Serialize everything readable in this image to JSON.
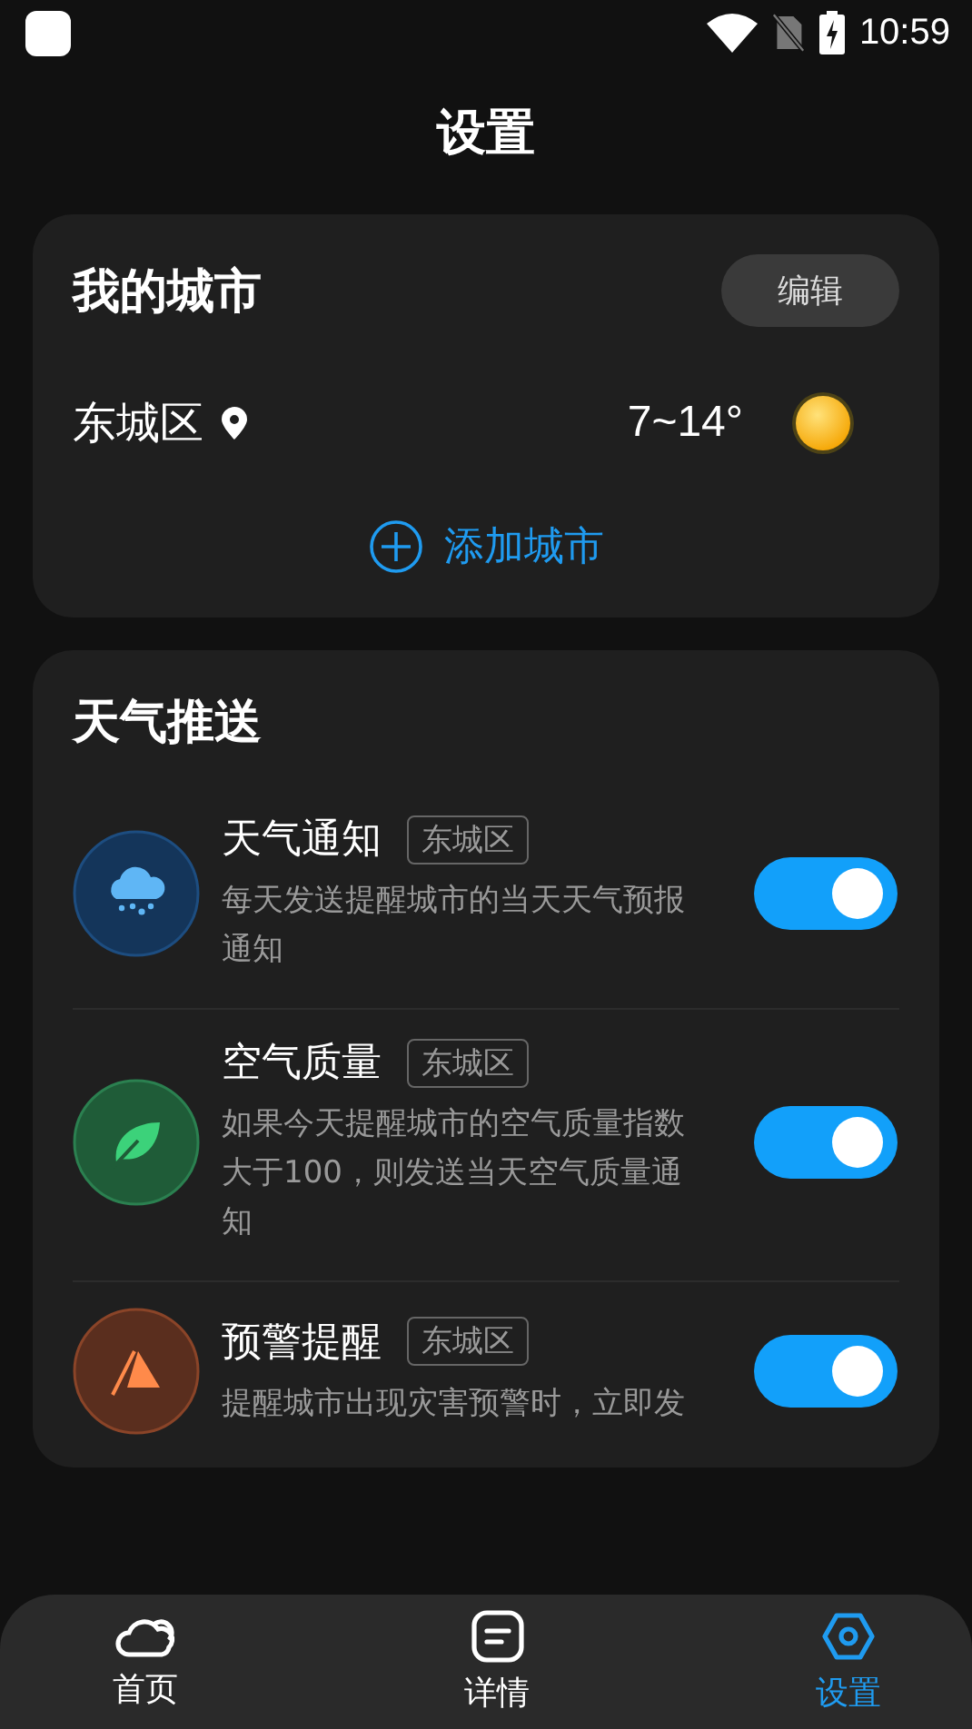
{
  "status_bar": {
    "time": "10:59"
  },
  "title": "设置",
  "my_cities": {
    "title": "我的城市",
    "edit_button": "编辑",
    "cities": [
      {
        "name": "东城区",
        "temperature": "7~14°"
      }
    ],
    "add_button": "添加城市"
  },
  "weather_push": {
    "title": "天气推送",
    "items": [
      {
        "kind": "weather",
        "title": "天气通知",
        "tag": "东城区",
        "description": "每天发送提醒城市的当天天气预报通知",
        "on": true
      },
      {
        "kind": "air",
        "title": "空气质量",
        "tag": "东城区",
        "description": "如果今天提醒城市的空气质量指数大于100，则发送当天空气质量通知",
        "on": true
      },
      {
        "kind": "alert",
        "title": "预警提醒",
        "tag": "东城区",
        "description": "提醒城市出现灾害预警时，立即发",
        "on": true
      }
    ]
  },
  "bottom_nav": [
    {
      "kind": "home",
      "label": "首页",
      "selected": false
    },
    {
      "kind": "details",
      "label": "详情",
      "selected": false
    },
    {
      "kind": "settings",
      "label": "设置",
      "selected": true
    }
  ]
}
